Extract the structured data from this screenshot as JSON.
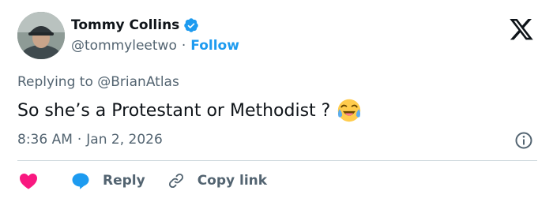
{
  "author": {
    "name": "Tommy Collins",
    "handle": "@tommyleetwo",
    "follow_label": "Follow",
    "verified": true
  },
  "tweet": {
    "reply_prefix": "Replying to ",
    "reply_target": "@BrianAtlas",
    "text": "So she’s a Protestant or Methodist ?",
    "emoji": "face-with-tears-of-joy-icon",
    "time": "8:36 AM",
    "date": "Jan 2, 2026"
  },
  "actions": {
    "reply_label": "Reply",
    "copy_label": "Copy link"
  },
  "colors": {
    "accent": "#1d9bf0",
    "text": "#0f1419",
    "muted": "#536471",
    "like": "#f91880"
  }
}
